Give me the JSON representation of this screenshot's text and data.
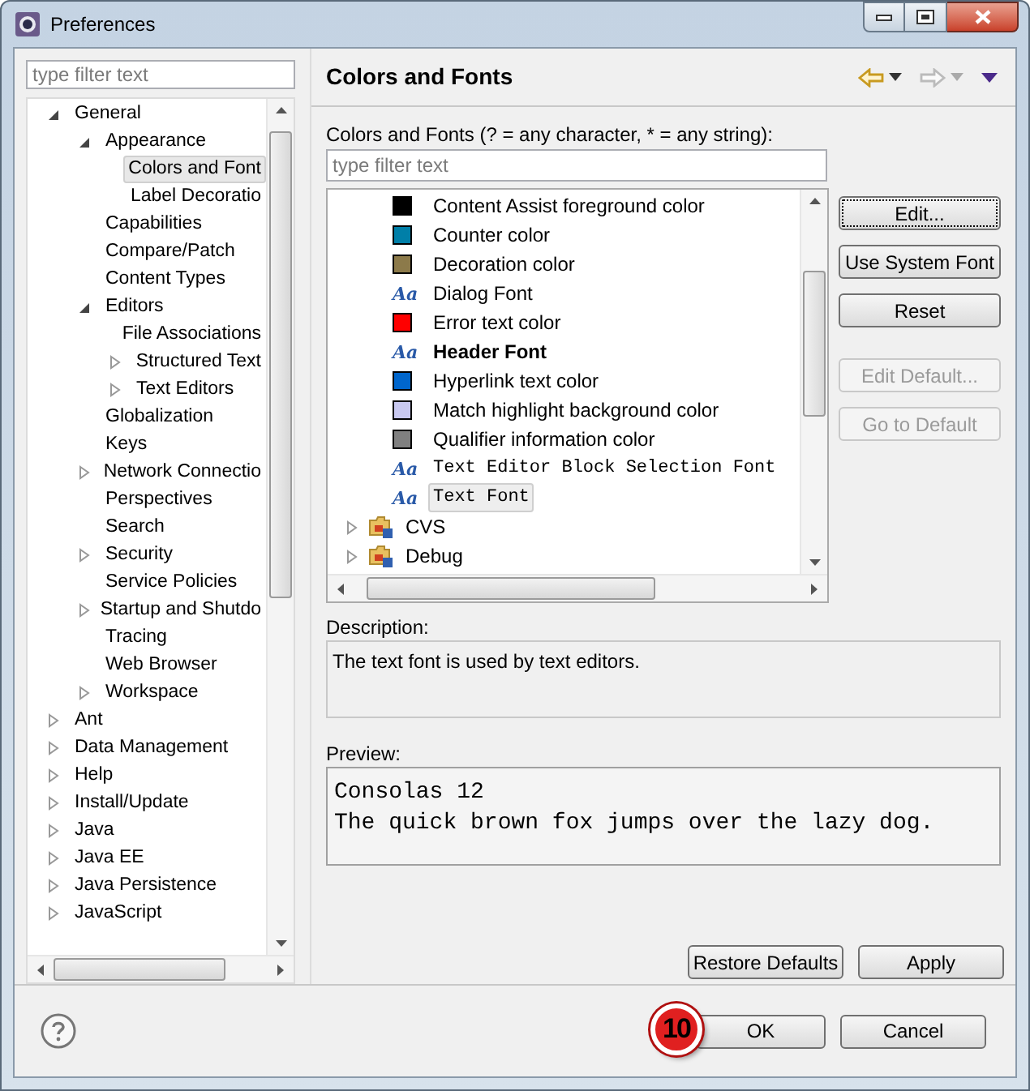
{
  "window": {
    "title": "Preferences"
  },
  "filter": {
    "placeholder": "type filter text"
  },
  "nav_tree": [
    {
      "label": "General",
      "kind": "branch",
      "expanded": true,
      "selected": false,
      "children": [
        {
          "label": "Appearance",
          "kind": "branch",
          "expanded": true,
          "selected": false,
          "children": [
            {
              "label": "Colors and Font",
              "kind": "leaf",
              "selected": true
            },
            {
              "label": "Label Decoratio",
              "kind": "leaf",
              "selected": false
            }
          ]
        },
        {
          "label": "Capabilities",
          "kind": "leaf",
          "selected": false
        },
        {
          "label": "Compare/Patch",
          "kind": "leaf",
          "selected": false
        },
        {
          "label": "Content Types",
          "kind": "leaf",
          "selected": false
        },
        {
          "label": "Editors",
          "kind": "branch",
          "expanded": true,
          "selected": false,
          "children": [
            {
              "label": "File Associations",
              "kind": "leaf",
              "selected": false
            },
            {
              "label": "Structured Text",
              "kind": "branch",
              "expanded": false,
              "selected": false
            },
            {
              "label": "Text Editors",
              "kind": "branch",
              "expanded": false,
              "selected": false
            }
          ]
        },
        {
          "label": "Globalization",
          "kind": "leaf",
          "selected": false
        },
        {
          "label": "Keys",
          "kind": "leaf",
          "selected": false
        },
        {
          "label": "Network Connectio",
          "kind": "branch",
          "expanded": false,
          "selected": false
        },
        {
          "label": "Perspectives",
          "kind": "leaf",
          "selected": false
        },
        {
          "label": "Search",
          "kind": "leaf",
          "selected": false
        },
        {
          "label": "Security",
          "kind": "branch",
          "expanded": false,
          "selected": false
        },
        {
          "label": "Service Policies",
          "kind": "leaf",
          "selected": false
        },
        {
          "label": "Startup and Shutdo",
          "kind": "branch",
          "expanded": false,
          "selected": false
        },
        {
          "label": "Tracing",
          "kind": "leaf",
          "selected": false
        },
        {
          "label": "Web Browser",
          "kind": "leaf",
          "selected": false
        },
        {
          "label": "Workspace",
          "kind": "branch",
          "expanded": false,
          "selected": false
        }
      ]
    },
    {
      "label": "Ant",
      "kind": "branch",
      "expanded": false,
      "selected": false
    },
    {
      "label": "Data Management",
      "kind": "branch",
      "expanded": false,
      "selected": false
    },
    {
      "label": "Help",
      "kind": "branch",
      "expanded": false,
      "selected": false
    },
    {
      "label": "Install/Update",
      "kind": "branch",
      "expanded": false,
      "selected": false
    },
    {
      "label": "Java",
      "kind": "branch",
      "expanded": false,
      "selected": false
    },
    {
      "label": "Java EE",
      "kind": "branch",
      "expanded": false,
      "selected": false
    },
    {
      "label": "Java Persistence",
      "kind": "branch",
      "expanded": false,
      "selected": false
    },
    {
      "label": "JavaScript",
      "kind": "branch",
      "expanded": false,
      "selected": false
    }
  ],
  "page": {
    "title": "Colors and Fonts",
    "filter_label": "Colors and Fonts (? = any character, * = any string):",
    "filter": {
      "placeholder": "type filter text"
    },
    "items": [
      {
        "label": "Content Assist foreground color",
        "kind": "color",
        "color": "#000000",
        "selected": false
      },
      {
        "label": "Counter color",
        "kind": "color",
        "color": "#007fa8",
        "selected": false
      },
      {
        "label": "Decoration color",
        "kind": "color",
        "color": "#8c7a4a",
        "selected": false
      },
      {
        "label": "Dialog Font",
        "kind": "font",
        "icon": "Aa",
        "selected": false
      },
      {
        "label": "Error text color",
        "kind": "color",
        "color": "#ff0000",
        "selected": false
      },
      {
        "label": "Header Font",
        "kind": "boldfont",
        "icon": "Aa",
        "selected": false
      },
      {
        "label": "Hyperlink text color",
        "kind": "color",
        "color": "#0066cc",
        "selected": false
      },
      {
        "label": "Match highlight background color",
        "kind": "color",
        "color": "#c8c8f0",
        "selected": false
      },
      {
        "label": "Qualifier information color",
        "kind": "color",
        "color": "#808080",
        "selected": false
      },
      {
        "label": "Text Editor Block Selection Font",
        "kind": "monofont",
        "icon": "Aa",
        "selected": false
      },
      {
        "label": "Text Font",
        "kind": "monofont",
        "icon": "Aa",
        "selected": true
      },
      {
        "label": "CVS",
        "kind": "category",
        "selected": false
      },
      {
        "label": "Debug",
        "kind": "category",
        "selected": false
      }
    ],
    "side_buttons": [
      {
        "label": "Edit...",
        "disabled": false
      },
      {
        "label": "Use System Font",
        "disabled": false
      },
      {
        "label": "Reset",
        "disabled": false
      },
      {
        "label": "Edit Default...",
        "disabled": true
      },
      {
        "label": "Go to Default",
        "disabled": true
      }
    ],
    "description_label": "Description:",
    "description": "The text font is used by text editors.",
    "preview_label": "Preview:",
    "preview": [
      "Consolas 12",
      "The quick brown fox jumps over the lazy dog."
    ],
    "buttons": [
      "Restore Defaults",
      "Apply"
    ]
  },
  "dialog_buttons": [
    "OK",
    "Cancel"
  ],
  "callout": {
    "label": "10"
  }
}
